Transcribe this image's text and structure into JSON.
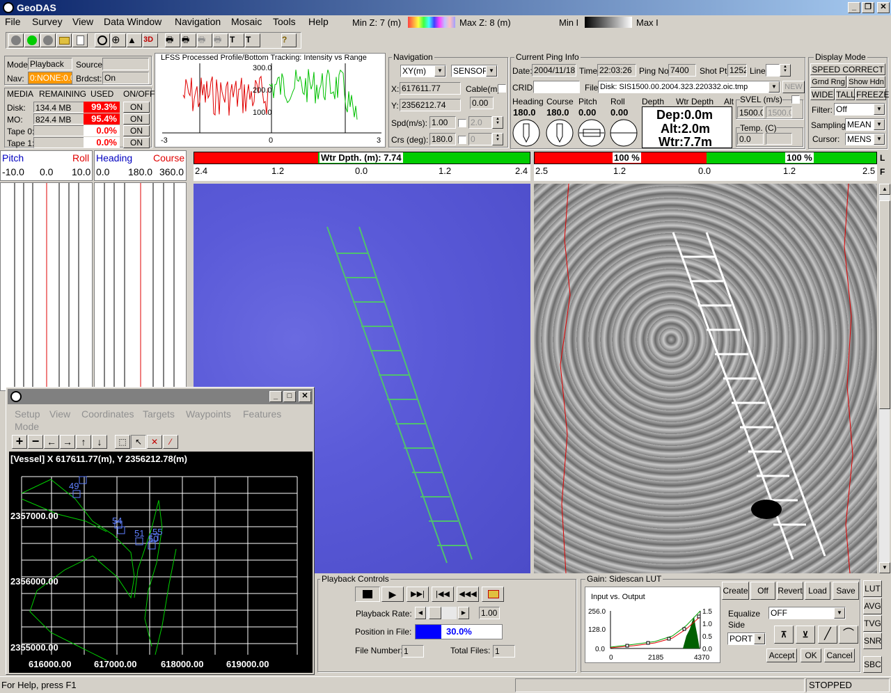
{
  "app": {
    "title": "GeoDAS"
  },
  "menu": {
    "file": "File",
    "survey": "Survey",
    "view": "View",
    "data_window": "Data Window",
    "navigation": "Navigation",
    "mosaic": "Mosaic",
    "tools": "Tools",
    "help": "Help",
    "min_z": "Min Z: 7 (m)",
    "max_z": "Max Z: 8 (m)",
    "min_i": "Min I",
    "max_i": "Max I"
  },
  "status": {
    "mode_label": "Mode:",
    "mode_value": "Playback",
    "source_label": "Source:",
    "source_value": "",
    "nav_label": "Nav:",
    "nav_value": "0:NONE:0.0",
    "brdcst_label": "Brdcst:",
    "brdcst_value": "On"
  },
  "media": {
    "headers": [
      "MEDIA",
      "REMAINING",
      "USED",
      "ON/OFF"
    ],
    "rows": [
      {
        "name": "Disk:",
        "remaining": "134.4 MB",
        "used": "99.3%",
        "state": "ON"
      },
      {
        "name": "MO:",
        "remaining": "824.4 MB",
        "used": "95.4%",
        "state": "ON"
      },
      {
        "name": "Tape 0:",
        "remaining": "",
        "used": "0.0%",
        "state": "ON"
      },
      {
        "name": "Tape 1:",
        "remaining": "",
        "used": "0.0%",
        "state": "ON"
      }
    ]
  },
  "profile": {
    "title": "LFSS Processed Profile/Bottom Tracking: Intensity vs Range",
    "y_ticks": [
      "300.0",
      "200.0",
      "100.0"
    ],
    "x_ticks": [
      "-3",
      "0",
      "3"
    ]
  },
  "navigation": {
    "title": "Navigation",
    "coord_mode": "XY(m)",
    "sensor": "SENSOR",
    "x_label": "X:",
    "x_value": "617611.77",
    "y_label": "Y:",
    "y_value": "2356212.74",
    "cable_label": "Cable(m):",
    "cable_value": "0.00",
    "spd_label": "Spd(m/s):",
    "spd_value": "1.00",
    "spd_alt": "2.0",
    "crs_label": "Crs (deg):",
    "crs_value": "180.0",
    "crs_alt": "0"
  },
  "ping": {
    "title": "Current Ping Info",
    "date_label": "Date:",
    "date": "2004/11/18",
    "time_label": "Time:",
    "time": "22:03:26",
    "ping_label": "Ping No:",
    "ping": "7400",
    "shot_label": "Shot Pt:",
    "shot": "1252",
    "line_label": "Line:",
    "crid_label": "CRID:",
    "file_label": "File:",
    "file": "Disk: SIS1500.00.2004.323.220332.oic.tmp",
    "new_label": "NEW",
    "heading_label": "Heading",
    "heading": "180.0",
    "course_label": "Course",
    "course": "180.0",
    "pitch_label": "Pitch",
    "pitch": "0.00",
    "roll_label": "Roll",
    "roll": "0.00",
    "depth_label": "Depth",
    "wtr_depth_label": "Wtr Depth",
    "alt_label": "Alt",
    "dep": "Dep:0.0m",
    "alt": "Alt:2.0m",
    "wtr": "Wtr:7.7m",
    "svel_label": "SVEL (m/s)",
    "svel": "1500.0",
    "svel_alt": "1500.0",
    "temp_label": "Temp. (C)",
    "temp": "0.0"
  },
  "display_mode": {
    "title": "Display Mode",
    "speed_correct": "SPEED CORRECT",
    "grnd_rng": "Grnd Rng",
    "show_hdn": "Show Hdn",
    "wide": "WIDE",
    "tall": "TALL",
    "freeze": "FREEZE",
    "filter_label": "Filter:",
    "filter": "Off",
    "sampling_label": "Sampling:",
    "sampling": "MEAN",
    "cursor_label": "Cursor:",
    "cursor": "MENS"
  },
  "attitude": {
    "pitch_label": "Pitch",
    "roll_label": "Roll",
    "heading_label": "Heading",
    "course_label": "Course",
    "pr_ticks": [
      "-10.0",
      "0.0",
      "10.0"
    ],
    "hc_ticks": [
      "0.0",
      "180.0",
      "360.0"
    ]
  },
  "wtr_bar": {
    "label": "Wtr Dpth. (m): 7.74",
    "ticks": [
      "2.4",
      "1.2",
      "0.0",
      "1.2",
      "2.4"
    ]
  },
  "sonar_bar": {
    "left_pct": "100 %",
    "right_pct": "100 %",
    "ticks": [
      "2.5",
      "1.2",
      "0.0",
      "1.2",
      "2.5"
    ],
    "l": "L",
    "f": "F"
  },
  "nav_window": {
    "menu": [
      "Setup",
      "View",
      "Coordinates",
      "Targets",
      "Waypoints",
      "Features",
      "Mode"
    ],
    "vessel": "[Vessel] X 617611.77(m), Y 2356212.78(m)",
    "y_ticks": [
      "2357000.00",
      "2356000.00",
      "2355000.00"
    ],
    "x_ticks": [
      "616000.00",
      "617000.00",
      "618000.00",
      "619000.00"
    ],
    "targets": [
      "49",
      "54",
      "51",
      "55",
      "50"
    ]
  },
  "playback": {
    "title": "Playback Controls",
    "rate_label": "Playback Rate:",
    "rate": "1.00",
    "position_label": "Position in File:",
    "position": "30.0%",
    "position_fraction": 0.3,
    "file_number_label": "File Number:",
    "file_number": "1",
    "total_files_label": "Total Files:",
    "total_files": "1"
  },
  "gain": {
    "title": "Gain: Sidescan LUT",
    "chart_title": "Input vs. Output",
    "y_ticks": [
      "256.0",
      "128.0",
      "0.0"
    ],
    "x_ticks": [
      "0",
      "2185",
      "4370"
    ],
    "r_ticks": [
      "1.5",
      "1.0",
      "0.5",
      "0.0"
    ],
    "create": "Create",
    "off": "Off",
    "revert": "Revert",
    "load": "Load",
    "save": "Save",
    "equalize_label": "Equalize",
    "equalize": "OFF",
    "side_label": "Side",
    "side": "PORT",
    "accept": "Accept",
    "ok": "OK",
    "cancel": "Cancel",
    "side_buttons": [
      "LUT",
      "AVG",
      "TVG",
      "SNR",
      "SBC"
    ]
  },
  "statusbar": {
    "help": "For Help, press F1",
    "state": "STOPPED"
  }
}
